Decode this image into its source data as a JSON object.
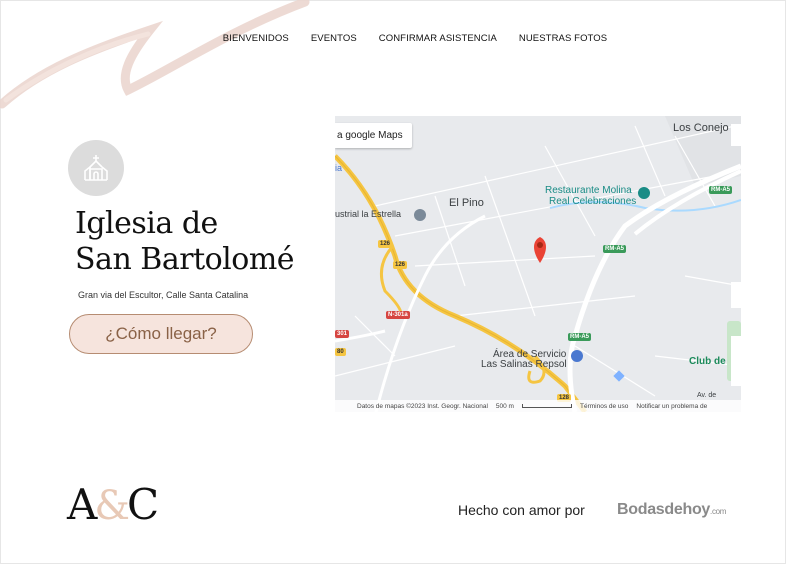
{
  "nav": {
    "items": [
      {
        "label": "BIENVENIDOS"
      },
      {
        "label": "EVENTOS"
      },
      {
        "label": "CONFIRMAR ASISTENCIA"
      },
      {
        "label": "NUESTRAS FOTOS"
      }
    ]
  },
  "venue": {
    "title_line1": "Iglesia de",
    "title_line2": "San Bartolomé",
    "address": "Gran via del Escultor, Calle Santa Catalina",
    "directions_button": "¿Cómo llegar?"
  },
  "map": {
    "open_link": "a google Maps",
    "places": {
      "los_conejos": "Los Conejo",
      "el_pino": "El Pino",
      "industrial": "ustrial la Estrella",
      "restaurante_line1": "Restaurante Molina",
      "restaurante_line2": "Real Celebraciones",
      "area_line1": "Área de Servicio",
      "area_line2": "Las Salinas Repsol",
      "club": "Club de",
      "av": "Av. de",
      "ia": "ia"
    },
    "road_labels": {
      "rm_a5_1": "RM-A5",
      "rm_a5_2": "RM-A5",
      "rm_a5_3": "RM-A5",
      "r126_1": "126",
      "r126_2": "126",
      "r126_3": "128",
      "n301a": "N-301a",
      "r301": "301",
      "r80": "80"
    },
    "attribution": {
      "data": "Datos de mapas ©2023 Inst. Geogr. Nacional",
      "scale": "500 m",
      "terms": "Términos de uso",
      "report": "Notificar un problema de"
    },
    "colors": {
      "pin": "#ea4335",
      "highway": "#f5c542",
      "road": "#ffffff",
      "water": "#aadaff"
    }
  },
  "footer": {
    "monogram_left": "A",
    "monogram_amp": "&",
    "monogram_right": "C",
    "made_with": "Hecho con amor por",
    "brand": "Bodasdehoy",
    "brand_suffix": ".com"
  },
  "colors": {
    "accent": "#f6e4dd",
    "accent_border": "#b68c72",
    "icon_bg": "#dcdcdc"
  }
}
